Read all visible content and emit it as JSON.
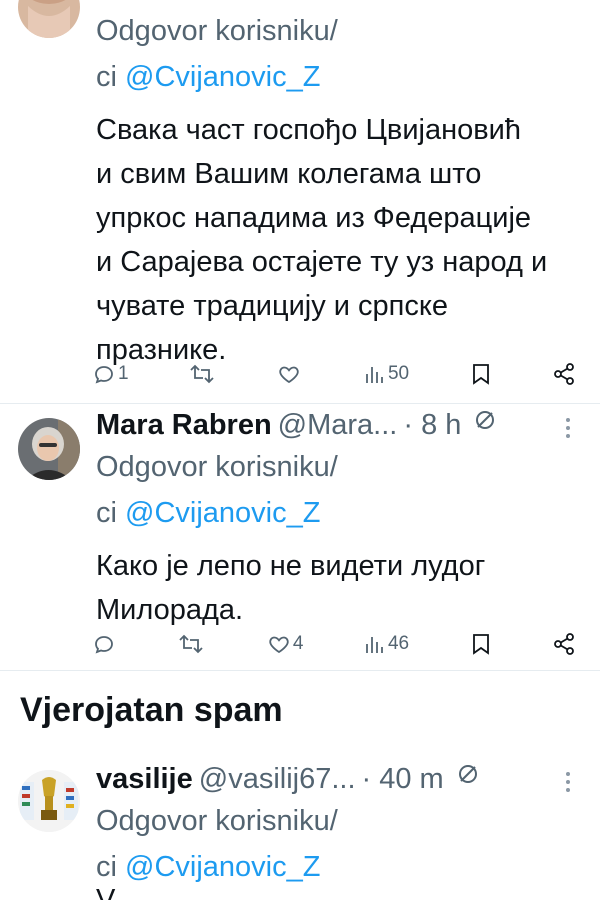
{
  "tweets": [
    {
      "reply_label": "Odgovor korisniku/",
      "reply_prefix": "ci ",
      "mention": "@Cvijanovic_Z",
      "text_lines": [
        "Свака част госпођо Цвијановић",
        "и свим Вашим колегама што",
        "упркос нападима из Федерације",
        "и Сарајева остајете ту уз народ и",
        "чувате традицију и српске",
        "празнике."
      ],
      "actions": {
        "replies": "1",
        "retweets": "",
        "likes": "",
        "views": "50"
      }
    },
    {
      "name": "Mara Rabren",
      "handle": "@Mara...",
      "time": "· 8 h",
      "reply_label": "Odgovor korisniku/",
      "reply_prefix": "ci ",
      "mention": "@Cvijanovic_Z",
      "text_lines": [
        "Како је лепо не видети лудог",
        "Милорада."
      ],
      "actions": {
        "replies": "",
        "retweets": "",
        "likes": "4",
        "views": "46"
      }
    },
    {
      "name": "vasilije",
      "handle": "@vasilij67...",
      "time": "· 40 m",
      "reply_label": "Odgovor korisniku/",
      "reply_prefix": "ci ",
      "mention": "@Cvijanovic_Z",
      "text_cut": "V"
    }
  ],
  "section_title": "Vjerojatan spam",
  "icons": {
    "reply": "reply-icon",
    "retweet": "retweet-icon",
    "like": "heart-icon",
    "views": "views-icon",
    "bookmark": "bookmark-icon",
    "share": "share-icon",
    "more": "more-icon",
    "muted": "muted-icon"
  },
  "colors": {
    "text": "#0f1419",
    "secondary": "#536471",
    "link": "#1d9bf0",
    "divider": "#e6ecf0"
  }
}
